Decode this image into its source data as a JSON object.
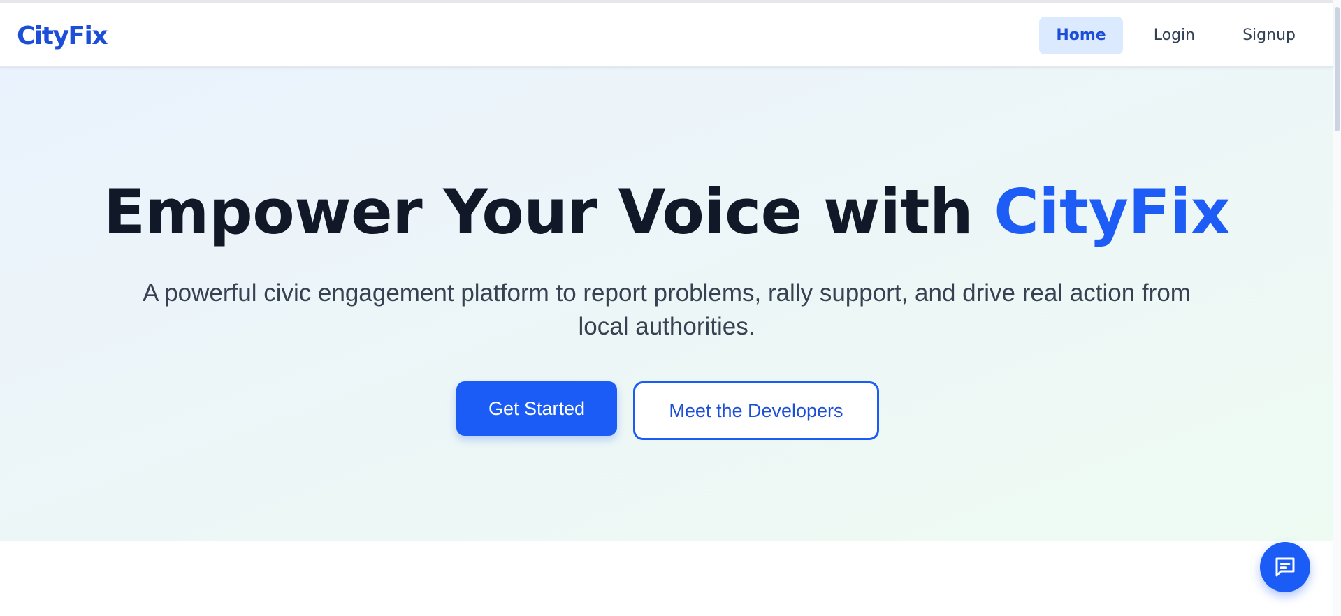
{
  "nav": {
    "brand": "CityFix",
    "links": [
      {
        "label": "Home",
        "active": true
      },
      {
        "label": "Login",
        "active": false
      },
      {
        "label": "Signup",
        "active": false
      }
    ]
  },
  "hero": {
    "title_main": "Empower Your Voice with ",
    "title_accent": "CityFix",
    "subtitle": "A powerful civic engagement platform to report problems, rally support, and drive real action from local authorities.",
    "primary_cta": "Get Started",
    "secondary_cta": "Meet the Developers"
  },
  "chat": {
    "icon": "chat-icon"
  },
  "colors": {
    "accent": "#1a5cf5",
    "brand": "#1d4ed8",
    "nav_active_bg": "#dbeafe",
    "heading": "#111827"
  }
}
